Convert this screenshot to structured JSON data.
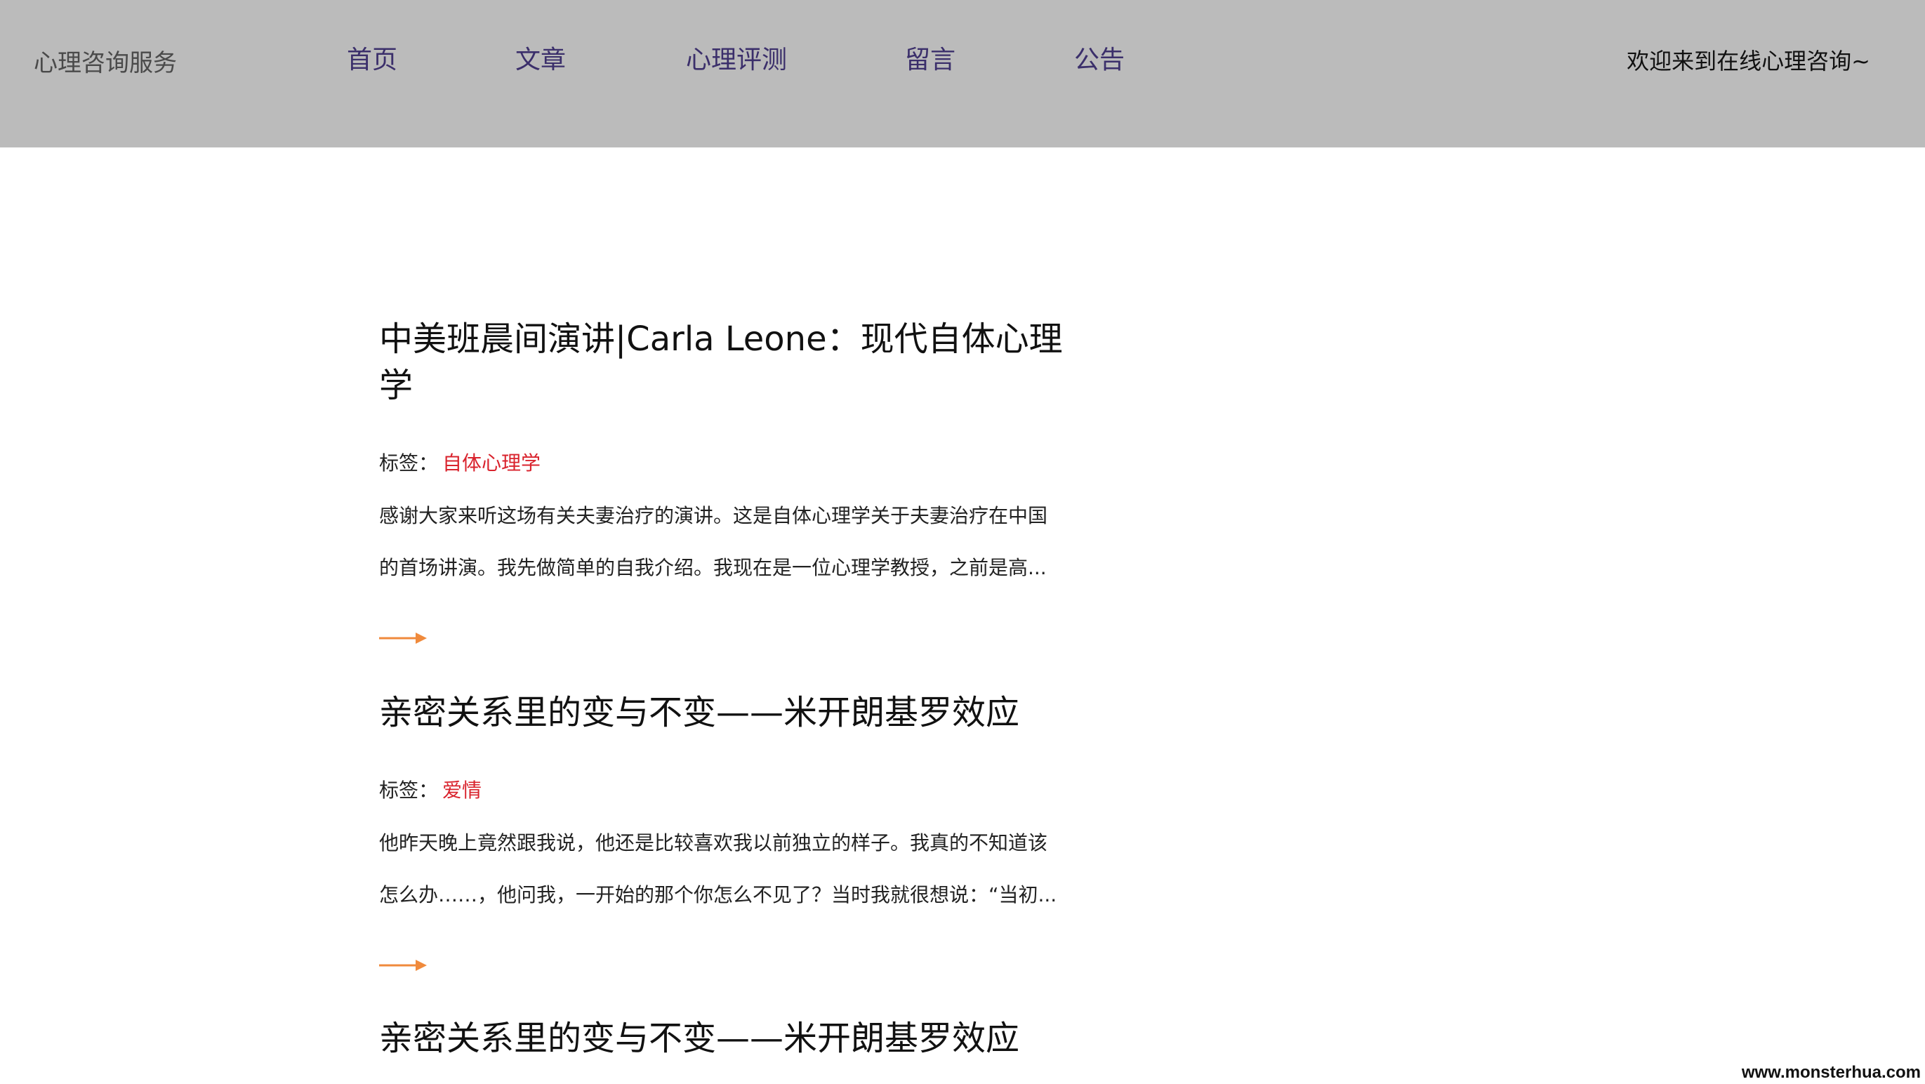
{
  "header": {
    "brand": "心理咨询服务",
    "nav": [
      "首页",
      "文章",
      "心理评测",
      "留言",
      "公告"
    ],
    "welcome": "欢迎来到在线心理咨询~"
  },
  "articles": [
    {
      "title": "中美班晨间演讲|Carla Leone：现代自体心理学",
      "tag_label": "标签：",
      "tag": "自体心理学",
      "excerpt_lines": [
        "感谢大家来听这场有关夫妻治疗的演讲。这是自体心理学关于夫妻治疗在中国",
        "的首场讲演。我先做简单的自我介绍。我现在是一位心理学教授，之前是高..."
      ]
    },
    {
      "title": "亲密关系里的变与不变——米开朗基罗效应",
      "tag_label": "标签：",
      "tag": "爱情",
      "excerpt_lines": [
        "他昨天晚上竟然跟我说，他还是比较喜欢我以前独立的样子。我真的不知道该",
        "怎么办……，他问我，一开始的那个你怎么不见了？当时我就很想说：“当初..."
      ]
    },
    {
      "title": "亲密关系里的变与不变——米开朗基罗效应"
    }
  ],
  "colors": {
    "header_bg": "#bbbbbb",
    "nav_text": "#3b2f6b",
    "tag_red": "#d9232d",
    "arrow_orange": "#f08a3c"
  },
  "icons": {
    "read_more": "right-arrow-icon"
  },
  "watermark": "www.monsterhua.com"
}
